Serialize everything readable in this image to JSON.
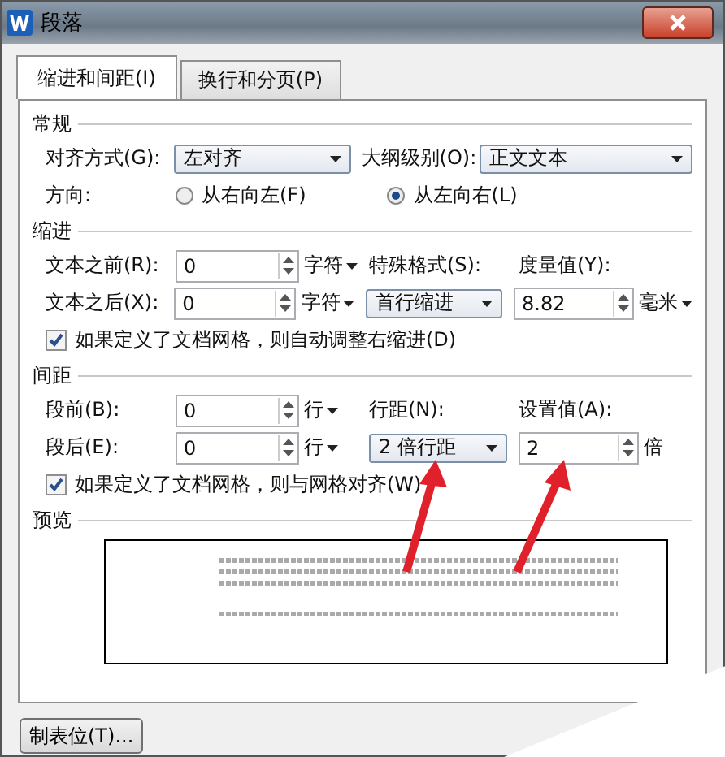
{
  "window": {
    "title": "段落"
  },
  "tabs": [
    {
      "label": "缩进和间距(I)",
      "selected": true
    },
    {
      "label": "换行和分页(P)",
      "selected": false
    }
  ],
  "general": {
    "heading": "常规",
    "alignment": {
      "label": "对齐方式(G):",
      "value": "左对齐"
    },
    "outline": {
      "label": "大纲级别(O):",
      "value": "正文文本"
    },
    "direction": {
      "label": "方向:",
      "options": [
        {
          "label": "从右向左(F)",
          "selected": false
        },
        {
          "label": "从左向右(L)",
          "selected": true
        }
      ]
    }
  },
  "indent": {
    "heading": "缩进",
    "before": {
      "label": "文本之前(R):",
      "value": "0",
      "unit": "字符"
    },
    "after": {
      "label": "文本之后(X):",
      "value": "0",
      "unit": "字符"
    },
    "special": {
      "label": "特殊格式(S):",
      "value": "首行缩进"
    },
    "measure": {
      "label": "度量值(Y):",
      "value": "8.82",
      "unit": "毫米"
    },
    "checkbox": {
      "label": "如果定义了文档网格，则自动调整右缩进(D)",
      "checked": true
    }
  },
  "spacing": {
    "heading": "间距",
    "before": {
      "label": "段前(B):",
      "value": "0",
      "unit": "行"
    },
    "after": {
      "label": "段后(E):",
      "value": "0",
      "unit": "行"
    },
    "line_spacing": {
      "label": "行距(N):",
      "value": "2 倍行距"
    },
    "set_value": {
      "label": "设置值(A):",
      "value": "2",
      "unit": "倍"
    },
    "checkbox": {
      "label": "如果定义了文档网格，则与网格对齐(W)",
      "checked": true
    }
  },
  "preview": {
    "heading": "预览"
  },
  "tab_stops_button": "制表位(T)..."
}
